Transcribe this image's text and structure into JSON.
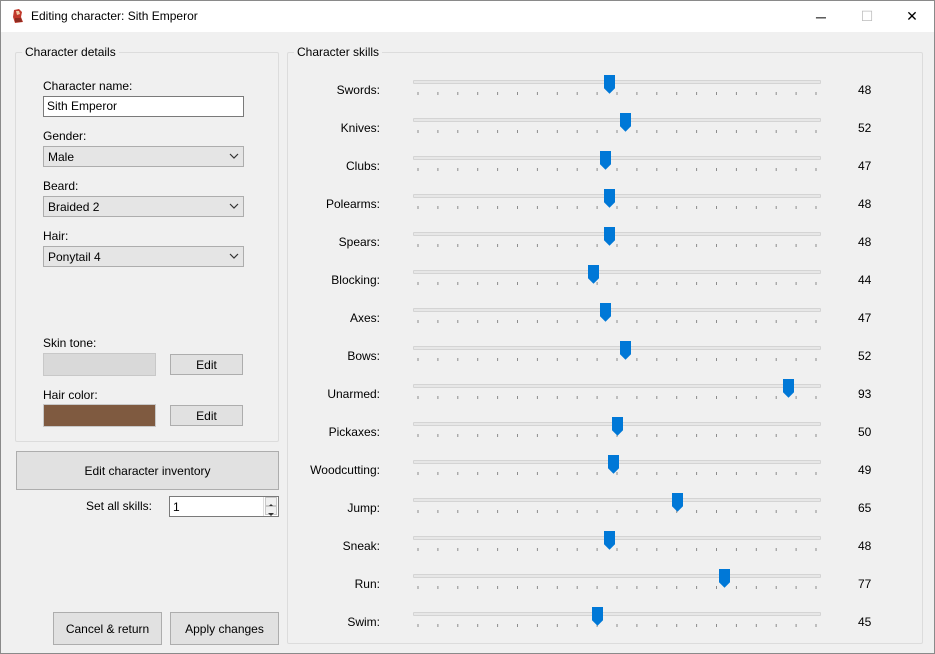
{
  "window": {
    "title": "Editing character: Sith Emperor",
    "minimize": "─",
    "maximize": "☐",
    "close": "✕"
  },
  "details": {
    "group_title": "Character details",
    "name_label": "Character name:",
    "name_value": "Sith Emperor",
    "gender_label": "Gender:",
    "gender_value": "Male",
    "beard_label": "Beard:",
    "beard_value": "Braided 2",
    "hair_label": "Hair:",
    "hair_value": "Ponytail 4",
    "skin_label": "Skin tone:",
    "skin_color": "#d9d9d9",
    "hair_color_label": "Hair color:",
    "hair_color": "#7f5a40",
    "edit_label": "Edit"
  },
  "inventory_button": "Edit character inventory",
  "set_all": {
    "label": "Set all skills:",
    "value": "1"
  },
  "footer": {
    "cancel": "Cancel & return",
    "apply": "Apply changes"
  },
  "skills": {
    "group_title": "Character skills",
    "min": 0,
    "max": 100,
    "accent": "#0078d7",
    "items": [
      {
        "name": "Swords:",
        "value": 48
      },
      {
        "name": "Knives:",
        "value": 52
      },
      {
        "name": "Clubs:",
        "value": 47
      },
      {
        "name": "Polearms:",
        "value": 48
      },
      {
        "name": "Spears:",
        "value": 48
      },
      {
        "name": "Blocking:",
        "value": 44
      },
      {
        "name": "Axes:",
        "value": 47
      },
      {
        "name": "Bows:",
        "value": 52
      },
      {
        "name": "Unarmed:",
        "value": 93
      },
      {
        "name": "Pickaxes:",
        "value": 50
      },
      {
        "name": "Woodcutting:",
        "value": 49
      },
      {
        "name": "Jump:",
        "value": 65
      },
      {
        "name": "Sneak:",
        "value": 48
      },
      {
        "name": "Run:",
        "value": 77
      },
      {
        "name": "Swim:",
        "value": 45
      }
    ]
  }
}
